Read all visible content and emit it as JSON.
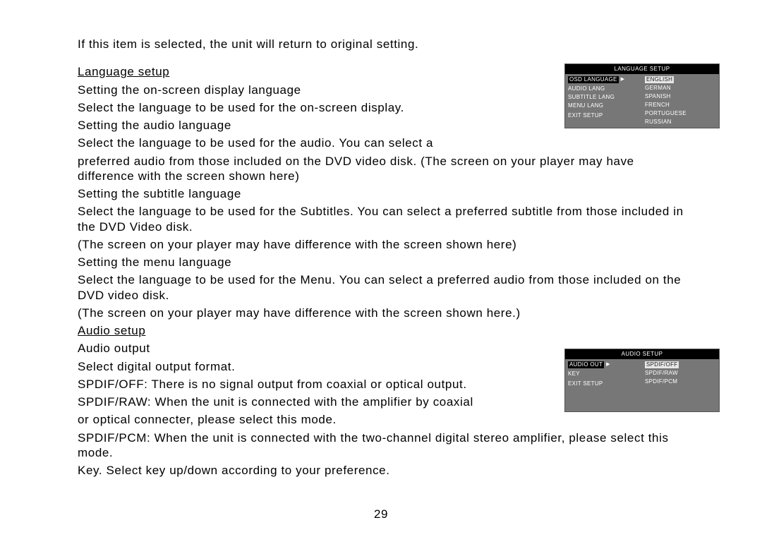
{
  "intro": "If this item is selected, the unit will return to original setting.",
  "lang": {
    "heading": "Language setup",
    "osd_h": "Setting the on-screen display language",
    "osd_b": "Select the language to be used for the on-screen display.",
    "audio_h": "Setting the audio language",
    "audio_b1": "Select the language to be used for the audio. You can select a",
    "audio_b2": "preferred audio from those included on the DVD video disk. (The screen on your player may have difference with the screen shown here)",
    "sub_h": "Setting the subtitle language",
    "sub_b1": "Select the language to be used for the Subtitles. You can select a preferred subtitle from those included in the DVD Video disk.",
    "sub_b2": "(The screen on your player may have difference with the screen shown here)",
    "menu_h": "Setting the menu language",
    "menu_b1": "Select the language to be used for the Menu. You can select a preferred audio from those included on the DVD video disk.",
    "menu_b2": "(The screen on your player may have difference with the screen shown here.)"
  },
  "audio": {
    "heading": "Audio setup",
    "out_h": "Audio output",
    "out_b": "Select digital output format.",
    "spdif_off": "SPDIF/OFF: There is no signal output from coaxial or optical output.",
    "spdif_raw1": "SPDIF/RAW: When the unit is connected with the amplifier by coaxial",
    "spdif_raw2": "or optical connecter, please select this mode.",
    "spdif_pcm": "SPDIF/PCM: When the unit is connected with the two-channel digital stereo amplifier, please select this mode.",
    "key": "Key. Select key up/down according to your preference."
  },
  "page_number": "29",
  "menu_lang": {
    "title": "LANGUAGE SETUP",
    "left": [
      "OSD LANGUAGE",
      "AUDIO LANG",
      "SUBTITLE LANG",
      "MENU LANG",
      "",
      "EXIT SETUP"
    ],
    "right": [
      "ENGLISH",
      "GERMAN",
      "SPANISH",
      "FRENCH",
      "PORTUGUESE",
      "RUSSIAN"
    ]
  },
  "menu_audio": {
    "title": "AUDIO SETUP",
    "left": [
      "AUDIO OUT",
      "KEY",
      "",
      "EXIT SETUP",
      "",
      ""
    ],
    "right": [
      "SPDIF/OFF",
      "SPDIF/RAW",
      "SPDIF/PCM",
      "",
      "",
      ""
    ]
  }
}
